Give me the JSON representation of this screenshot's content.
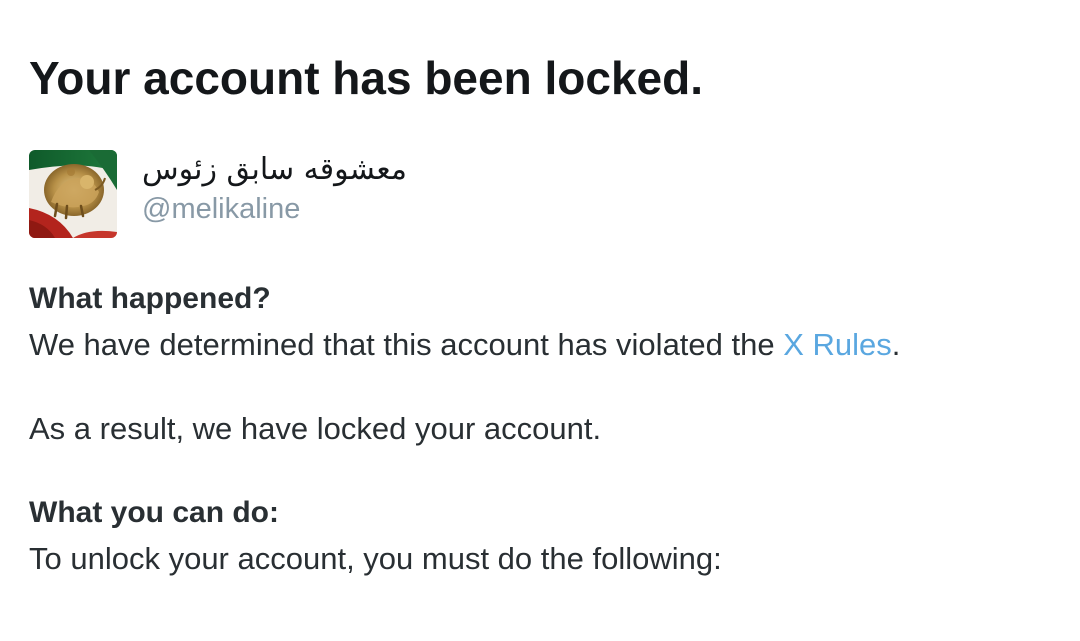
{
  "header": {
    "title": "Your account has been locked."
  },
  "account": {
    "display_name": "معشوقه سابق زئوس",
    "handle": "@melikaline",
    "avatar": "flag-lion-sun-avatar"
  },
  "what_happened": {
    "heading": "What happened?",
    "text_before_link": "We have determined that this account has violated the ",
    "link_label": "X Rules",
    "text_after_link": ".",
    "result_text": "As a result, we have locked your account."
  },
  "what_you_can_do": {
    "heading": "What you can do:",
    "text": "To unlock your account, you must do the following:"
  },
  "colors": {
    "link": "#5aa7e0",
    "handle": "#8899a6",
    "text": "#292f33"
  }
}
